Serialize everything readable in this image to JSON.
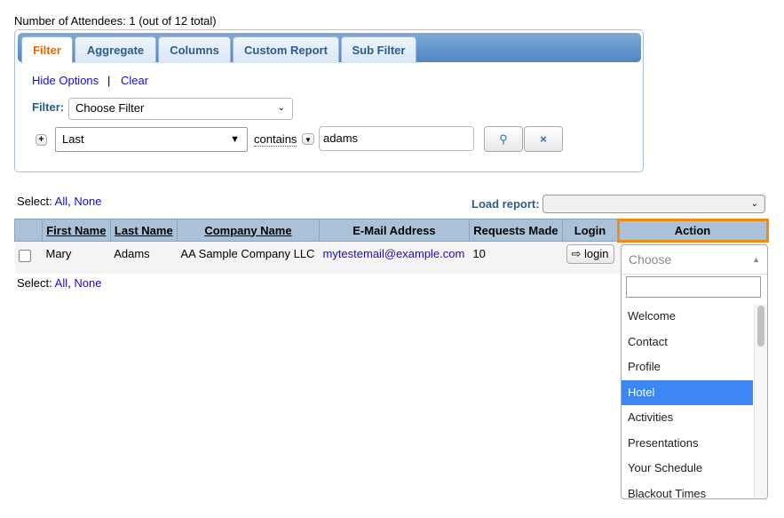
{
  "header": {
    "attendee_count": "Number of Attendees: 1 (out of 12 total)"
  },
  "tabs": [
    "Filter",
    "Aggregate",
    "Columns",
    "Custom Report",
    "Sub Filter"
  ],
  "filter_panel": {
    "hide_options": "Hide Options",
    "separator": "|",
    "clear": "Clear",
    "filter_label": "Filter:",
    "filter_select": "Choose Filter",
    "field_select": "Last",
    "operator": "contains",
    "value": "adams"
  },
  "select_links": {
    "label": "Select:",
    "all": "All",
    "none": "None"
  },
  "load_report": {
    "label": "Load report:",
    "value": ""
  },
  "table": {
    "headers": [
      "First Name",
      "Last Name",
      "Company Name",
      "E-Mail Address",
      "Requests Made",
      "Login",
      "Action"
    ],
    "rows": [
      {
        "first": "Mary",
        "last": "Adams",
        "company": "AA Sample Company LLC",
        "email": "mytestemail@example.com",
        "requests": "10",
        "login": "login"
      }
    ]
  },
  "action_dropdown": {
    "placeholder": "Choose",
    "search": "",
    "options": [
      "Welcome",
      "Contact",
      "Profile",
      "Hotel",
      "Activities",
      "Presentations",
      "Your Schedule",
      "Blackout Times"
    ],
    "highlighted": "Hotel"
  },
  "colors": {
    "accent": "#f28a1a",
    "header_bg": "#aac2d8",
    "highlight": "#3d87f5"
  }
}
